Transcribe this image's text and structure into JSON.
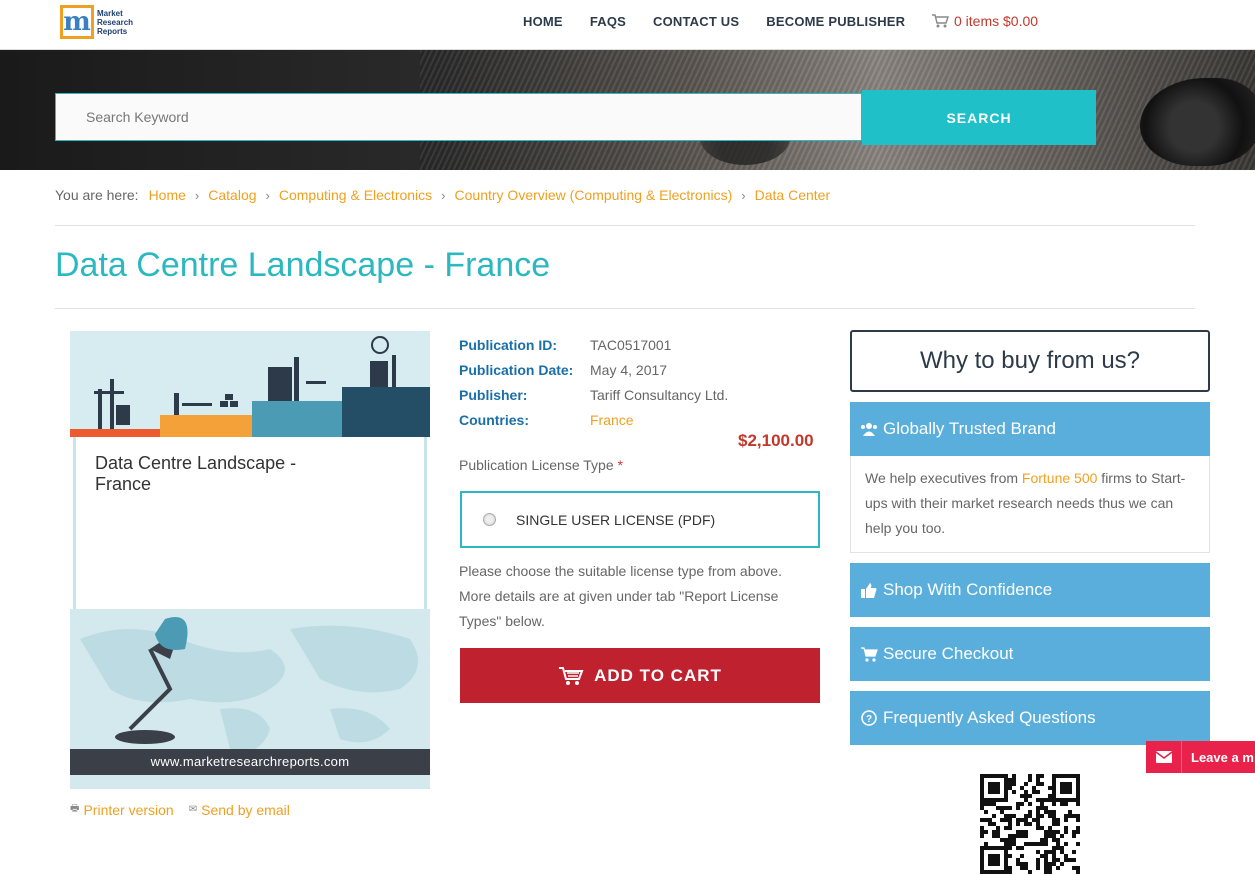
{
  "header": {
    "logo_text": [
      "Market",
      "Research",
      "Reports"
    ],
    "logo_letter": "m",
    "nav": [
      "HOME",
      "FAQS",
      "CONTACT US",
      "BECOME PUBLISHER"
    ],
    "cart": "0 items $0.00"
  },
  "search": {
    "placeholder": "Search Keyword",
    "button": "SEARCH"
  },
  "breadcrumb": {
    "label": "You are here:",
    "items": [
      "Home",
      "Catalog",
      "Computing & Electronics",
      "Country Overview (Computing & Electronics)",
      "Data Center"
    ]
  },
  "page_title": "Data Centre Landscape - France",
  "product_image": {
    "card_title": "Data Centre Landscape - France",
    "footer_url": "www.marketresearchreports.com"
  },
  "links": {
    "printer": "Printer version",
    "email": "Send by email"
  },
  "meta": [
    {
      "key": "Publication ID:",
      "value": "TAC0517001"
    },
    {
      "key": "Publication Date:",
      "value": "May 4, 2017"
    },
    {
      "key": "Publisher:",
      "value": "Tariff Consultancy Ltd."
    },
    {
      "key": "Countries:",
      "value": "France"
    }
  ],
  "price": "$2,100.00",
  "license": {
    "label": "Publication License Type",
    "required_mark": "*",
    "option": "SINGLE USER LICENSE (PDF)",
    "help": "Please choose the suitable license type from above. More details are at given under tab \"Report License Types\" below."
  },
  "add_to_cart": "ADD TO CART",
  "sidebar": {
    "why_title": "Why to buy from us?",
    "trusted": {
      "title": "Globally Trusted Brand",
      "body_before": "We help executives from ",
      "body_highlight": "Fortune 500",
      "body_after": " firms to Start-ups with their market research needs thus we can help you too."
    },
    "items": [
      "Shop With Confidence",
      "Secure Checkout",
      "Frequently Asked Questions"
    ]
  },
  "chat": "Leave a m",
  "colors": {
    "accent_teal": "#2bb8c0",
    "link_orange": "#f0a020",
    "cart_red": "#c0212f",
    "panel_blue": "#5aaedc"
  }
}
